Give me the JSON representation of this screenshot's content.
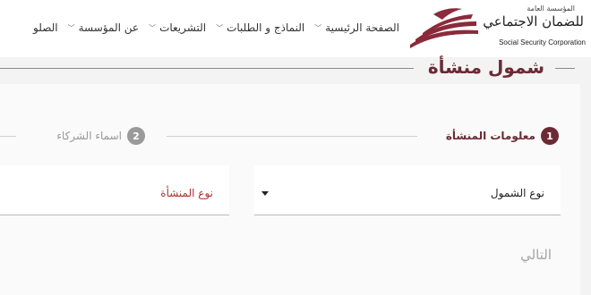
{
  "logo": {
    "org_small": "المؤسسة العامة",
    "org_arabic": "للضمان الاجتماعي",
    "org_english": "Social Security Corporation",
    "brand_color": "#8b2a3a"
  },
  "nav": {
    "items": [
      {
        "label": "الصفحة الرئيسية",
        "has_dropdown": true
      },
      {
        "label": "النماذج و الطلبات",
        "has_dropdown": true
      },
      {
        "label": "التشريعات",
        "has_dropdown": true
      },
      {
        "label": "عن المؤسسة",
        "has_dropdown": true
      },
      {
        "label": "الصلو",
        "has_dropdown": false
      }
    ]
  },
  "page": {
    "title": "شمول منشأة"
  },
  "stepper": {
    "steps": [
      {
        "number": "1",
        "label": "معلومات المنشأة",
        "active": true
      },
      {
        "number": "2",
        "label": "اسماء الشركاء",
        "active": false
      }
    ]
  },
  "form": {
    "coverage_type_label": "نوع الشمول",
    "establishment_type_label": "نوع المنشأة"
  },
  "actions": {
    "next_label": "التالي"
  },
  "colors": {
    "accent": "#6b2a34",
    "required_label": "#b03030",
    "inactive": "#9a9a9a"
  }
}
